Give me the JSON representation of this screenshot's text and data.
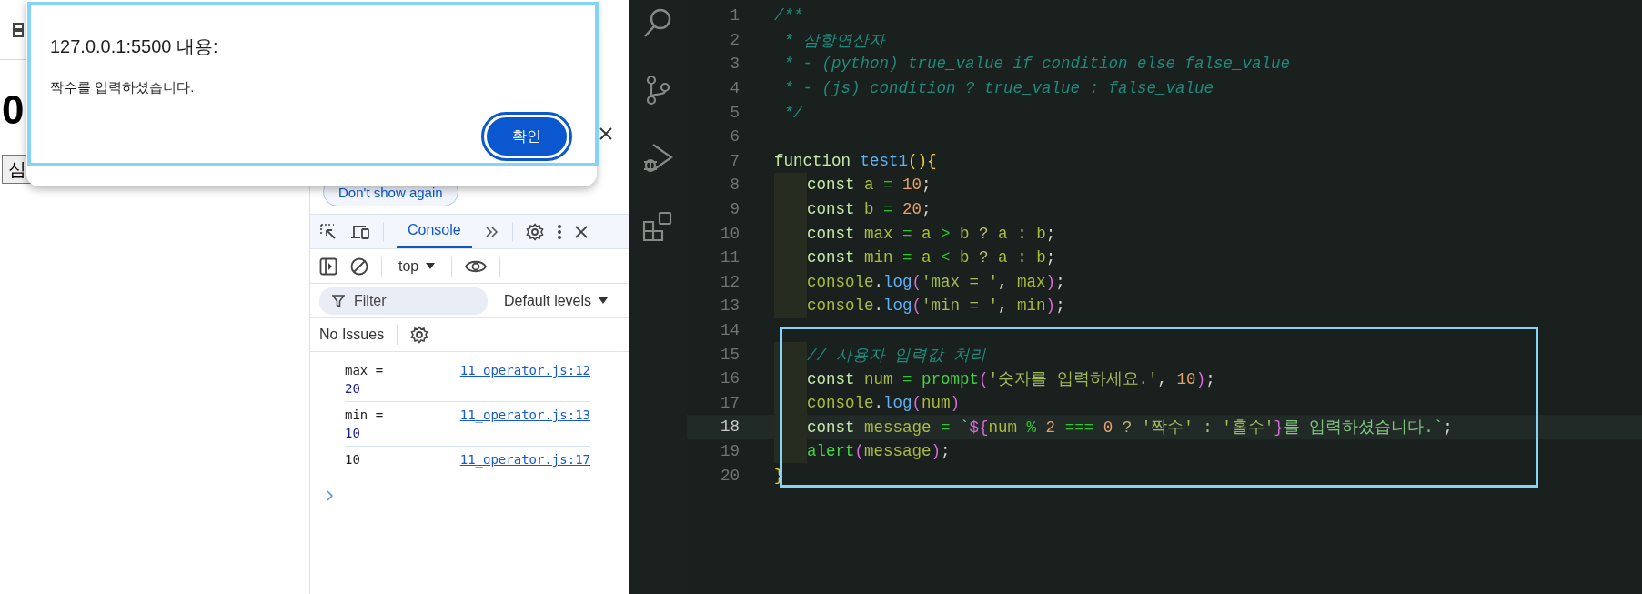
{
  "page": {
    "heading": "0",
    "button": "심"
  },
  "alert": {
    "title": "127.0.0.1:5500 내용:",
    "message": "짝수를 입력하셨습니다.",
    "ok": "확인"
  },
  "devtools": {
    "banner_button": "Don't show again",
    "tabs": [
      {
        "label": "Console",
        "selected": true
      }
    ],
    "context": "top",
    "filter": {
      "placeholder": "Filter"
    },
    "levels": "Default levels",
    "issues": "No Issues",
    "logs": [
      {
        "message": "max =",
        "value": "20",
        "source": "11_operator.js:12"
      },
      {
        "message": "min =",
        "value": "10",
        "source": "11_operator.js:13"
      },
      {
        "message": "10",
        "source": "11_operator.js:17"
      }
    ]
  },
  "editor": {
    "lines": [
      {
        "number": "1",
        "indent": false,
        "current": false,
        "tokens": [
          {
            "kind": "comment",
            "text": "/**"
          }
        ]
      },
      {
        "number": "2",
        "indent": false,
        "current": false,
        "tokens": [
          {
            "kind": "comment",
            "text": " * 삼항연산자"
          }
        ]
      },
      {
        "number": "3",
        "indent": false,
        "current": false,
        "tokens": [
          {
            "kind": "comment",
            "text": " * - (python) true_value if condition else false_value"
          }
        ]
      },
      {
        "number": "4",
        "indent": false,
        "current": false,
        "tokens": [
          {
            "kind": "comment",
            "text": " * - (js) condition ? true_value : false_value"
          }
        ]
      },
      {
        "number": "5",
        "indent": false,
        "current": false,
        "tokens": [
          {
            "kind": "comment",
            "text": " */"
          }
        ]
      },
      {
        "number": "6",
        "indent": false,
        "current": false
      },
      {
        "number": "7",
        "indent": false,
        "current": false,
        "tokens": [
          {
            "kind": "keyword",
            "text": "function "
          },
          {
            "kind": "function",
            "text": "test1"
          },
          {
            "kind": "bracket1",
            "text": "(){"
          }
        ]
      },
      {
        "number": "8",
        "indent": true,
        "current": false,
        "tokens": [
          {
            "kind": "keyword",
            "text": "const "
          },
          {
            "kind": "variable",
            "text": "a "
          },
          {
            "kind": "operator",
            "text": "= "
          },
          {
            "kind": "number",
            "text": "10"
          },
          {
            "kind": "punct",
            "text": ";"
          }
        ]
      },
      {
        "number": "9",
        "indent": true,
        "current": false,
        "tokens": [
          {
            "kind": "keyword",
            "text": "const "
          },
          {
            "kind": "variable",
            "text": "b "
          },
          {
            "kind": "operator",
            "text": "= "
          },
          {
            "kind": "number",
            "text": "20"
          },
          {
            "kind": "punct",
            "text": ";"
          }
        ]
      },
      {
        "number": "10",
        "indent": true,
        "current": false,
        "tokens": [
          {
            "kind": "keyword",
            "text": "const "
          },
          {
            "kind": "variable",
            "text": "max "
          },
          {
            "kind": "operator",
            "text": "= "
          },
          {
            "kind": "variable",
            "text": "a "
          },
          {
            "kind": "operator",
            "text": "> "
          },
          {
            "kind": "variable",
            "text": "b "
          },
          {
            "kind": "ternary",
            "text": "? "
          },
          {
            "kind": "variable",
            "text": "a "
          },
          {
            "kind": "ternary",
            "text": ": "
          },
          {
            "kind": "variable",
            "text": "b"
          },
          {
            "kind": "punct",
            "text": ";"
          }
        ]
      },
      {
        "number": "11",
        "indent": true,
        "current": false,
        "tokens": [
          {
            "kind": "keyword",
            "text": "const "
          },
          {
            "kind": "variable",
            "text": "min "
          },
          {
            "kind": "operator",
            "text": "= "
          },
          {
            "kind": "variable",
            "text": "a "
          },
          {
            "kind": "operator",
            "text": "< "
          },
          {
            "kind": "variable",
            "text": "b "
          },
          {
            "kind": "ternary",
            "text": "? "
          },
          {
            "kind": "variable",
            "text": "a "
          },
          {
            "kind": "ternary",
            "text": ": "
          },
          {
            "kind": "variable",
            "text": "b"
          },
          {
            "kind": "punct",
            "text": ";"
          }
        ]
      },
      {
        "number": "12",
        "indent": true,
        "current": false,
        "tokens": [
          {
            "kind": "variable",
            "text": "console"
          },
          {
            "kind": "punct",
            "text": "."
          },
          {
            "kind": "function",
            "text": "log"
          },
          {
            "kind": "bracket2",
            "text": "("
          },
          {
            "kind": "string",
            "text": "'max = '"
          },
          {
            "kind": "punct",
            "text": ", "
          },
          {
            "kind": "variable",
            "text": "max"
          },
          {
            "kind": "bracket2",
            "text": ")"
          },
          {
            "kind": "punct",
            "text": ";"
          }
        ]
      },
      {
        "number": "13",
        "indent": true,
        "current": false,
        "tokens": [
          {
            "kind": "variable",
            "text": "console"
          },
          {
            "kind": "punct",
            "text": "."
          },
          {
            "kind": "function",
            "text": "log"
          },
          {
            "kind": "bracket2",
            "text": "("
          },
          {
            "kind": "string",
            "text": "'min = '"
          },
          {
            "kind": "punct",
            "text": ", "
          },
          {
            "kind": "variable",
            "text": "min"
          },
          {
            "kind": "bracket2",
            "text": ")"
          },
          {
            "kind": "punct",
            "text": ";"
          }
        ]
      },
      {
        "number": "14",
        "indent": false,
        "current": false
      },
      {
        "number": "15",
        "indent": true,
        "current": false,
        "tokens": [
          {
            "kind": "comment",
            "text": "// 사용자 입력값 처리"
          }
        ]
      },
      {
        "number": "16",
        "indent": true,
        "current": false,
        "tokens": [
          {
            "kind": "keyword",
            "text": "const "
          },
          {
            "kind": "variable",
            "text": "num "
          },
          {
            "kind": "operator",
            "text": "= "
          },
          {
            "kind": "call",
            "text": "prompt"
          },
          {
            "kind": "bracket2",
            "text": "("
          },
          {
            "kind": "string",
            "text": "'숫자를 입력하세요.'"
          },
          {
            "kind": "punct",
            "text": ", "
          },
          {
            "kind": "number",
            "text": "10"
          },
          {
            "kind": "bracket2",
            "text": ")"
          },
          {
            "kind": "punct",
            "text": ";"
          }
        ]
      },
      {
        "number": "17",
        "indent": true,
        "current": false,
        "tokens": [
          {
            "kind": "variable",
            "text": "console"
          },
          {
            "kind": "punct",
            "text": "."
          },
          {
            "kind": "function",
            "text": "log"
          },
          {
            "kind": "bracket2",
            "text": "("
          },
          {
            "kind": "variable",
            "text": "num"
          },
          {
            "kind": "bracket2",
            "text": ")"
          }
        ]
      },
      {
        "number": "18",
        "indent": true,
        "current": true,
        "tokens": [
          {
            "kind": "keyword",
            "text": "const "
          },
          {
            "kind": "variable",
            "text": "message "
          },
          {
            "kind": "operator",
            "text": "= "
          },
          {
            "kind": "template",
            "text": "`"
          },
          {
            "kind": "bracket2",
            "text": "${"
          },
          {
            "kind": "variable",
            "text": "num "
          },
          {
            "kind": "operator",
            "text": "% "
          },
          {
            "kind": "number",
            "text": "2 "
          },
          {
            "kind": "operator",
            "text": "=== "
          },
          {
            "kind": "number",
            "text": "0 "
          },
          {
            "kind": "ternary",
            "text": "? "
          },
          {
            "kind": "string",
            "text": "'짝수' "
          },
          {
            "kind": "ternary",
            "text": ": "
          },
          {
            "kind": "string",
            "text": "'홀수'"
          },
          {
            "kind": "bracket2",
            "text": "}"
          },
          {
            "kind": "template",
            "text": "를 입력하셨습니다.`"
          },
          {
            "kind": "punct",
            "text": ";"
          }
        ]
      },
      {
        "number": "19",
        "indent": true,
        "current": false,
        "tokens": [
          {
            "kind": "call",
            "text": "alert"
          },
          {
            "kind": "bracket2",
            "text": "("
          },
          {
            "kind": "variable",
            "text": "message"
          },
          {
            "kind": "bracket2",
            "text": ")"
          },
          {
            "kind": "punct",
            "text": ";"
          }
        ]
      },
      {
        "number": "20",
        "indent": false,
        "current": false,
        "tokens": [
          {
            "kind": "bracket1",
            "text": "}"
          }
        ]
      }
    ]
  }
}
